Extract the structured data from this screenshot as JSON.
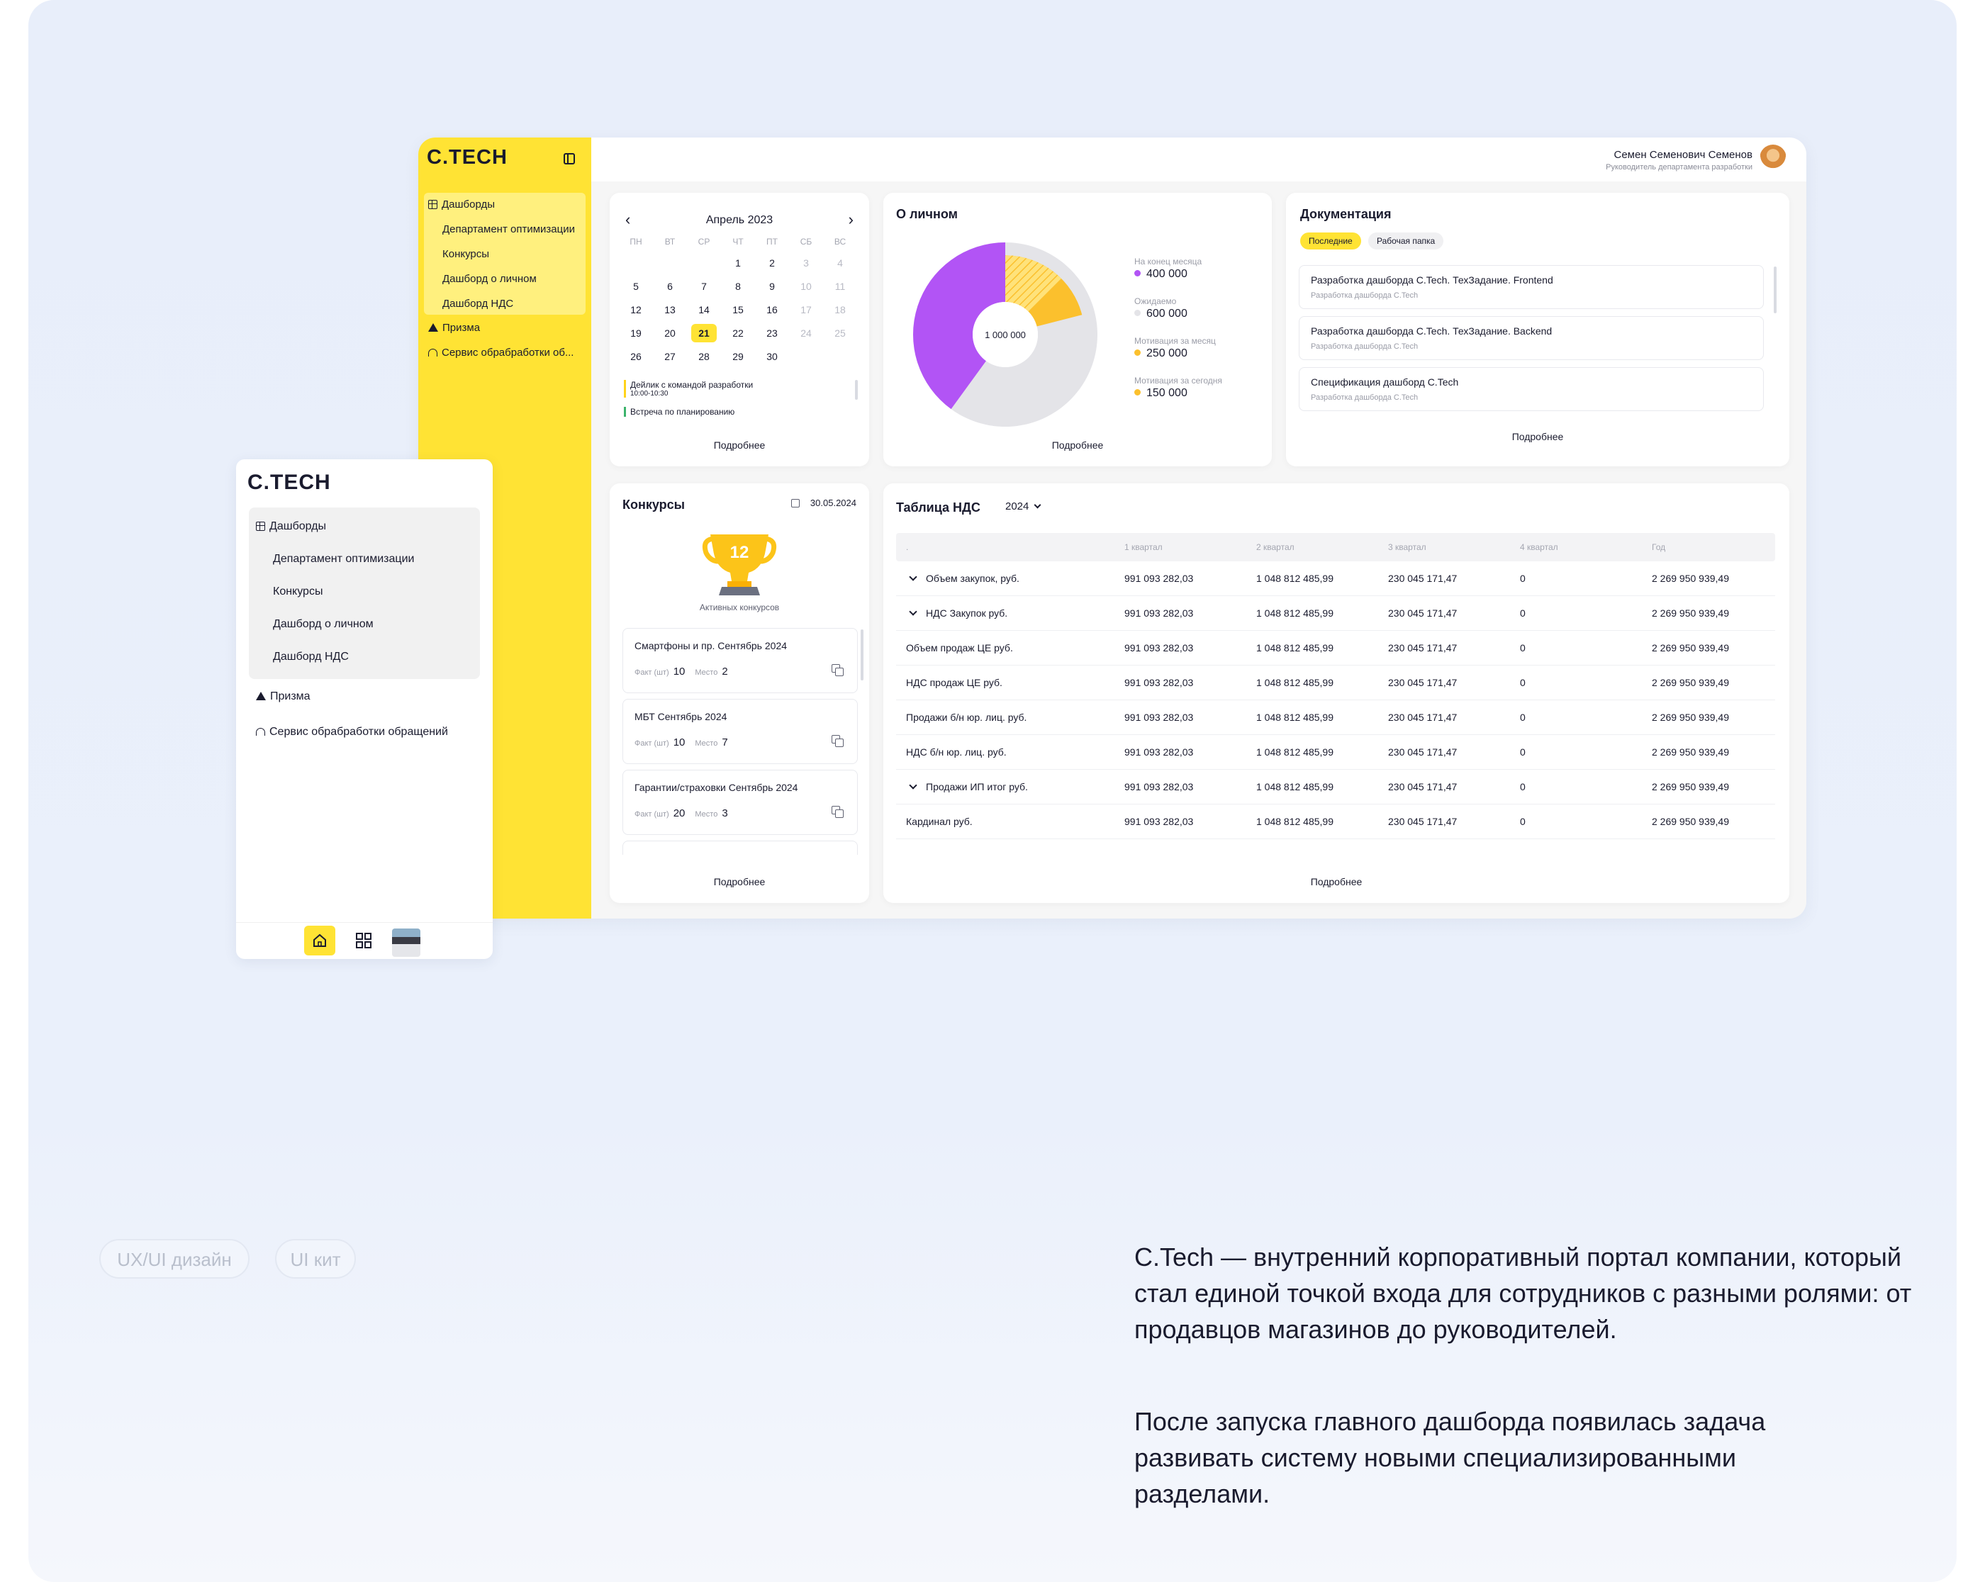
{
  "brand": "C.TECH",
  "colors": {
    "accent": "#ffe334",
    "purple": "#b254f5",
    "orange": "#fbc02d",
    "grey": "#e4e4e8",
    "text": "#1a1b2e"
  },
  "sidebar": {
    "group_label": "Дашборды",
    "sub_items": [
      "Департамент оптимизации",
      "Конкурсы",
      "Дашборд о личном",
      "Дашборд НДС"
    ],
    "items": [
      "Призма",
      "Сервис обрабработки об..."
    ]
  },
  "user": {
    "name": "Семен Семенович Семенов",
    "role": "Руководитель департамента разработки"
  },
  "calendar": {
    "month": "Апрель 2023",
    "weekdays": [
      "ПН",
      "ВТ",
      "СР",
      "ЧТ",
      "ПТ",
      "СБ",
      "ВС"
    ],
    "weeks": [
      [
        "",
        "",
        "",
        "",
        "1",
        "2",
        "3",
        "4"
      ],
      [
        "5",
        "6",
        "7",
        "8",
        "9",
        "10",
        "11"
      ],
      [
        "12",
        "13",
        "14",
        "15",
        "16",
        "17",
        "18"
      ],
      [
        "19",
        "20",
        "21",
        "22",
        "23",
        "24",
        "25"
      ],
      [
        "26",
        "27",
        "28",
        "29",
        "30",
        "",
        ""
      ]
    ],
    "today": "21",
    "events": [
      {
        "title": "Дейлик с командой разработки",
        "time": "10:00-10:30"
      },
      {
        "title": "Встреча по планированию",
        "time": ""
      }
    ],
    "more": "Подробнее"
  },
  "personal": {
    "title": "О личном",
    "center_value": "1 000 000",
    "legend": [
      {
        "label": "На конец месяца",
        "value": "400 000",
        "color": "#b254f5"
      },
      {
        "label": "Ожидаемо",
        "value": "600 000",
        "color": "#e4e4e8"
      },
      {
        "label": "Мотивация за месяц",
        "value": "250 000",
        "color": "#fbc02d"
      },
      {
        "label": "Мотивация за сегодня",
        "value": "150 000",
        "color": "#fbc02d"
      }
    ],
    "more": "Подробнее"
  },
  "chart_data": {
    "type": "pie",
    "title": "О личном",
    "categories": [
      "На конец месяца",
      "Ожидаемо",
      "Мотивация за месяц",
      "Мотивация за сегодня"
    ],
    "values": [
      400000,
      600000,
      250000,
      150000
    ]
  },
  "docs": {
    "title": "Документация",
    "tabs": [
      "Последние",
      "Рабочая папка"
    ],
    "items": [
      {
        "title": "Разработка дашборда C.Tech. ТехЗадание. Frontend",
        "sub": "Разработка дашборда C.Tech"
      },
      {
        "title": "Разработка дашборда C.Tech. ТехЗадание. Backend",
        "sub": "Разработка дашборда C.Tech"
      },
      {
        "title": "Спецификация дашборд C.Tech",
        "sub": "Разработка дашборда C.Tech"
      }
    ],
    "more": "Подробнее"
  },
  "contests": {
    "title": "Конкурсы",
    "date": "30.05.2024",
    "count": "12",
    "active_label": "Активных конкурсов",
    "fact_label": "Факт (шт)",
    "place_label": "Место",
    "items": [
      {
        "title": "Смартфоны и пр. Сентябрь 2024",
        "fact": "10",
        "place": "2"
      },
      {
        "title": "МБТ Сентябрь 2024",
        "fact": "10",
        "place": "7"
      },
      {
        "title": "Гарантии/страховки Сентябрь 2024",
        "fact": "20",
        "place": "3"
      }
    ],
    "more": "Подробнее"
  },
  "vat": {
    "title": "Таблица НДС",
    "year": "2024",
    "headers": [
      ".",
      "1 квартал",
      "2 квартал",
      "3 квартал",
      "4 квартал",
      "Год"
    ],
    "rows": [
      {
        "name": "Объем закупок, руб.",
        "expand": true,
        "q1": "991 093 282,03",
        "q2": "1 048 812 485,99",
        "q3": "230 045 171,47",
        "q4": "0",
        "year": "2 269 950 939,49"
      },
      {
        "name": "НДС Закупок руб.",
        "expand": true,
        "q1": "991 093 282,03",
        "q2": "1 048 812 485,99",
        "q3": "230 045 171,47",
        "q4": "0",
        "year": "2 269 950 939,49"
      },
      {
        "name": "Объем продаж ЦЕ руб.",
        "expand": false,
        "q1": "991 093 282,03",
        "q2": "1 048 812 485,99",
        "q3": "230 045 171,47",
        "q4": "0",
        "year": "2 269 950 939,49"
      },
      {
        "name": "НДС продаж ЦЕ руб.",
        "expand": false,
        "q1": "991 093 282,03",
        "q2": "1 048 812 485,99",
        "q3": "230 045 171,47",
        "q4": "0",
        "year": "2 269 950 939,49"
      },
      {
        "name": "Продажи б/н юр. лиц. руб.",
        "expand": false,
        "q1": "991 093 282,03",
        "q2": "1 048 812 485,99",
        "q3": "230 045 171,47",
        "q4": "0",
        "year": "2 269 950 939,49"
      },
      {
        "name": "НДС б/н юр. лиц. руб.",
        "expand": false,
        "q1": "991 093 282,03",
        "q2": "1 048 812 485,99",
        "q3": "230 045 171,47",
        "q4": "0",
        "year": "2 269 950 939,49"
      },
      {
        "name": "Продажи ИП итог руб.",
        "expand": true,
        "q1": "991 093 282,03",
        "q2": "1 048 812 485,99",
        "q3": "230 045 171,47",
        "q4": "0",
        "year": "2 269 950 939,49"
      },
      {
        "name": "Кардинал руб.",
        "expand": false,
        "q1": "991 093 282,03",
        "q2": "1 048 812 485,99",
        "q3": "230 045 171,47",
        "q4": "0",
        "year": "2 269 950 939,49"
      }
    ],
    "more": "Подробнее"
  },
  "mobile": {
    "brand": "C.TECH",
    "group_label": "Дашборды",
    "sub_items": [
      "Департамент оптимизации",
      "Конкурсы",
      "Дашборд о личном",
      "Дашборд НДС"
    ],
    "items": [
      "Призма",
      "Сервис обрабработки обращений"
    ]
  },
  "tags": [
    "UX/UI дизайн",
    "UI кит"
  ],
  "description": [
    "C.Tech — внутренний корпоративный портал компании, который стал единой точкой входа для сотрудников с разными ролями: от продавцов магазинов до руководителей.",
    "После запуска главного дашборда появилась задача развивать систему новыми специализированными разделами."
  ]
}
